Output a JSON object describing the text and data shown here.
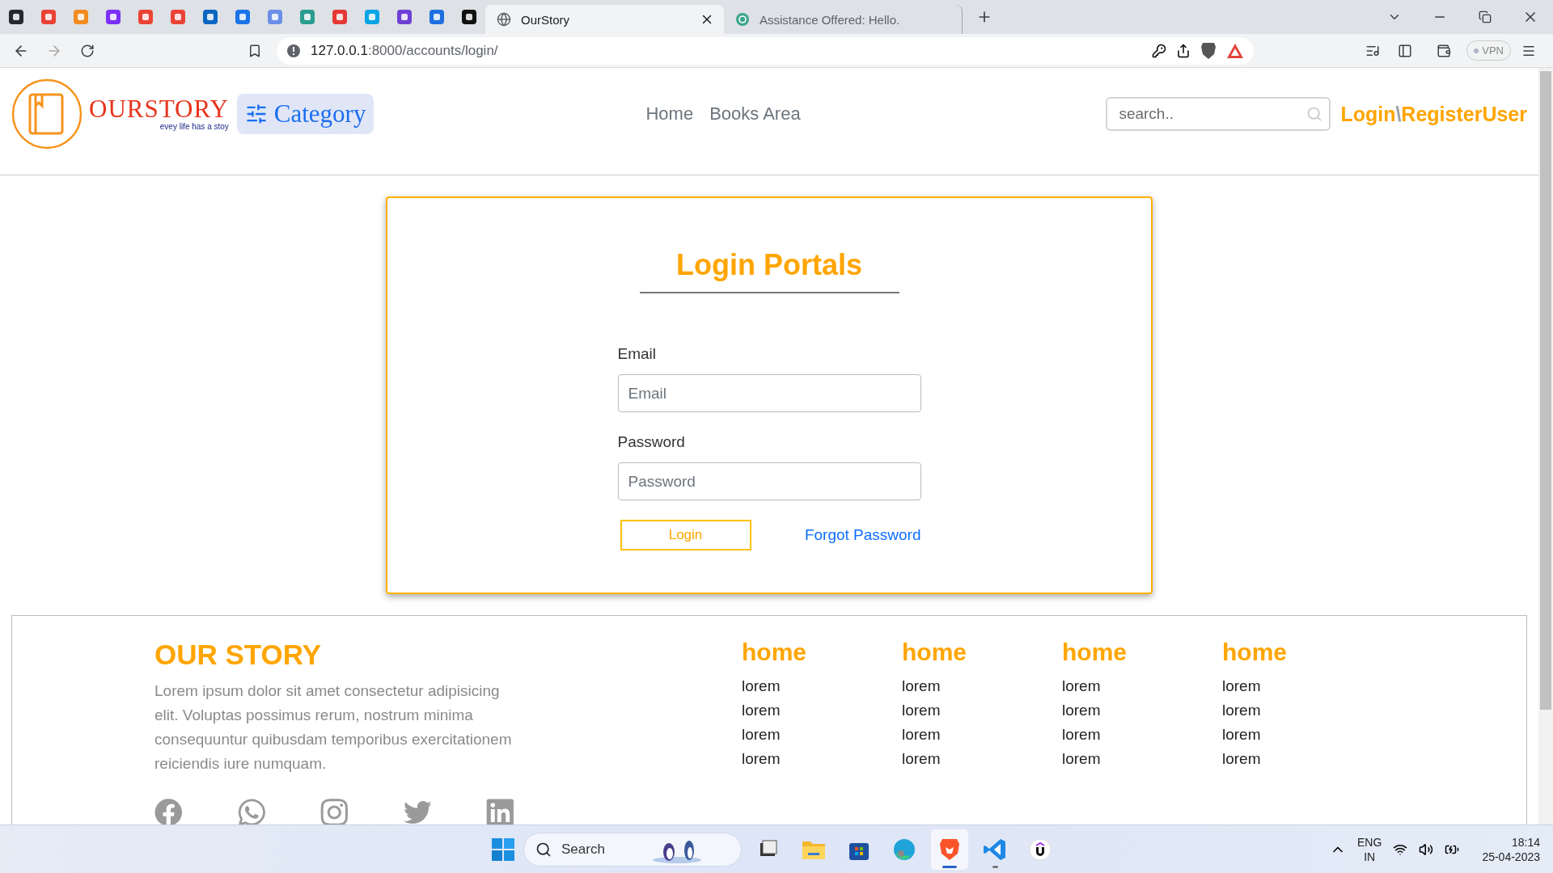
{
  "browser": {
    "tabs": [
      {
        "title": "OurStory",
        "selected": true
      },
      {
        "title": "Assistance Offered: Hello.",
        "selected": false
      }
    ],
    "address": {
      "host": "127.0.0.1",
      "path": ":8000/accounts/login/"
    },
    "vpn": "VPN"
  },
  "header": {
    "logo": {
      "name": "OURSTORY",
      "tagline": "evey life has a stoy"
    },
    "category": "Category",
    "nav": [
      {
        "label": "Home"
      },
      {
        "label": "Books Area"
      }
    ],
    "search": {
      "placeholder": "search.."
    },
    "account": {
      "login": "Login",
      "separator": "\\",
      "register": "RegisterUser"
    }
  },
  "login": {
    "title": "Login Portals",
    "fields": [
      {
        "label": "Email",
        "placeholder": "Email"
      },
      {
        "label": "Password",
        "placeholder": "Password"
      }
    ],
    "submit": "Login",
    "forgot": "Forgot Password"
  },
  "footer": {
    "brand": "OUR STORY",
    "about": "Lorem ipsum dolor sit amet consectetur adipisicing elit. Voluptas possimus rerum, nostrum minima consequuntur quibusdam temporibus exercitationem reiciendis iure numquam.",
    "columns": [
      {
        "heading": "home",
        "links": [
          "lorem",
          "lorem",
          "lorem",
          "lorem"
        ]
      },
      {
        "heading": "home",
        "links": [
          "lorem",
          "lorem",
          "lorem",
          "lorem"
        ]
      },
      {
        "heading": "home",
        "links": [
          "lorem",
          "lorem",
          "lorem",
          "lorem"
        ]
      },
      {
        "heading": "home",
        "links": [
          "lorem",
          "lorem",
          "lorem",
          "lorem"
        ]
      }
    ]
  },
  "taskbar": {
    "search": {
      "placeholder": "Search"
    },
    "apps": [
      {
        "kind": "desktop",
        "selected": false,
        "running": false
      },
      {
        "kind": "files",
        "selected": false,
        "running": false
      },
      {
        "kind": "store",
        "selected": false,
        "running": false
      },
      {
        "kind": "edge",
        "selected": false,
        "running": false
      },
      {
        "kind": "brave",
        "selected": true,
        "running": true
      },
      {
        "kind": "code",
        "selected": false,
        "running": true
      },
      {
        "kind": "learn",
        "selected": false,
        "running": false
      }
    ],
    "tray": {
      "language": "ENG",
      "region": "IN",
      "time": "18:14",
      "date": "25-04-2023"
    }
  }
}
